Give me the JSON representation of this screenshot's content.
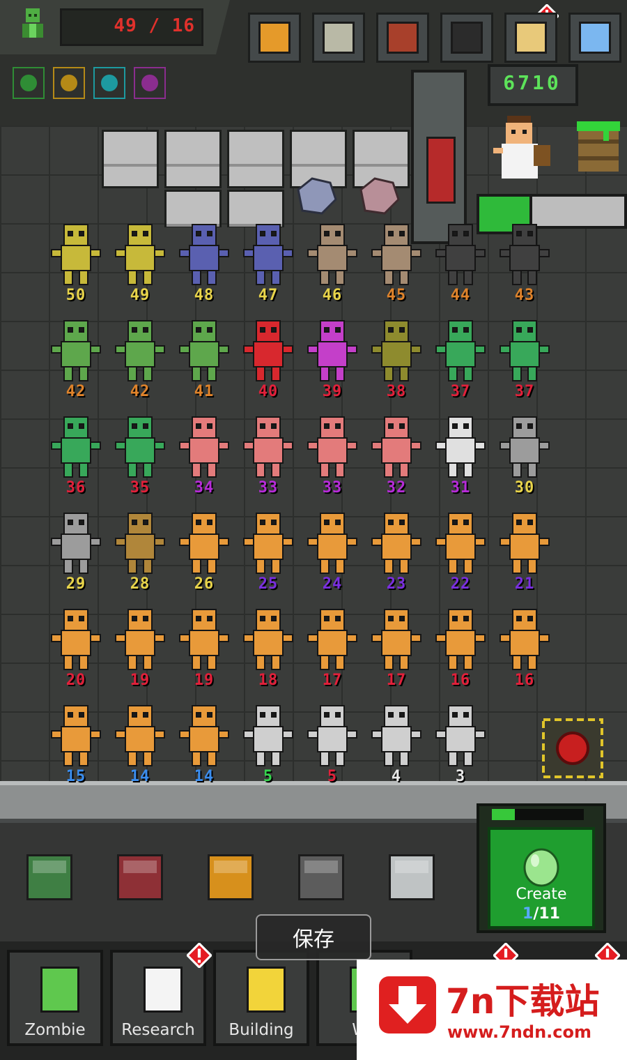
{
  "hud": {
    "population": "49 / 16",
    "money": "6710",
    "top_buttons": [
      {
        "icon": "trophy-icon",
        "color": "#e59a2a"
      },
      {
        "icon": "zombie-head-icon",
        "color": "#b9b9a6"
      },
      {
        "icon": "book-icon",
        "color": "#a8402b"
      },
      {
        "icon": "tablet-icon",
        "color": "#2b2b2b"
      },
      {
        "icon": "scroll-icon",
        "color": "#e8c97a"
      },
      {
        "icon": "gear-icon",
        "color": "#7bb7f0"
      }
    ],
    "boosts": [
      {
        "icon": "flask-boost-icon",
        "color": "#2f8d35"
      },
      {
        "icon": "bomb-boost-icon",
        "color": "#b58a17"
      },
      {
        "icon": "bomb-boost-2-icon",
        "color": "#1d9aa0"
      },
      {
        "icon": "trash-boost-icon",
        "color": "#8b2d8f"
      }
    ]
  },
  "zombie_grid": {
    "rows": [
      [
        {
          "lvl": "50",
          "color": "#e8d44a"
        },
        {
          "lvl": "49",
          "color": "#e8d44a"
        },
        {
          "lvl": "48",
          "color": "#e8d44a"
        },
        {
          "lvl": "47",
          "color": "#e8d44a"
        },
        {
          "lvl": "46",
          "color": "#e8d44a"
        },
        {
          "lvl": "45",
          "color": "#e0832a"
        },
        {
          "lvl": "44",
          "color": "#e0832a"
        },
        {
          "lvl": "43",
          "color": "#e0832a"
        }
      ],
      [
        {
          "lvl": "42",
          "color": "#e0832a"
        },
        {
          "lvl": "42",
          "color": "#e0832a"
        },
        {
          "lvl": "41",
          "color": "#e0832a"
        },
        {
          "lvl": "40",
          "color": "#e2203a"
        },
        {
          "lvl": "39",
          "color": "#e2203a"
        },
        {
          "lvl": "38",
          "color": "#e2203a"
        },
        {
          "lvl": "37",
          "color": "#e2203a"
        },
        {
          "lvl": "37",
          "color": "#e2203a"
        }
      ],
      [
        {
          "lvl": "36",
          "color": "#e2203a"
        },
        {
          "lvl": "35",
          "color": "#e2203a"
        },
        {
          "lvl": "34",
          "color": "#b62bd8"
        },
        {
          "lvl": "33",
          "color": "#b62bd8"
        },
        {
          "lvl": "33",
          "color": "#b62bd8"
        },
        {
          "lvl": "32",
          "color": "#b62bd8"
        },
        {
          "lvl": "31",
          "color": "#b62bd8"
        },
        {
          "lvl": "30",
          "color": "#e8d44a"
        }
      ],
      [
        {
          "lvl": "29",
          "color": "#e8d44a"
        },
        {
          "lvl": "28",
          "color": "#e8d44a"
        },
        {
          "lvl": "26",
          "color": "#e8d44a"
        },
        {
          "lvl": "25",
          "color": "#7a2ee0"
        },
        {
          "lvl": "24",
          "color": "#7a2ee0"
        },
        {
          "lvl": "23",
          "color": "#7a2ee0"
        },
        {
          "lvl": "22",
          "color": "#7a2ee0"
        },
        {
          "lvl": "21",
          "color": "#7a2ee0"
        }
      ],
      [
        {
          "lvl": "20",
          "color": "#e2203a"
        },
        {
          "lvl": "19",
          "color": "#e2203a"
        },
        {
          "lvl": "19",
          "color": "#e2203a"
        },
        {
          "lvl": "18",
          "color": "#e2203a"
        },
        {
          "lvl": "17",
          "color": "#e2203a"
        },
        {
          "lvl": "17",
          "color": "#e2203a"
        },
        {
          "lvl": "16",
          "color": "#e2203a"
        },
        {
          "lvl": "16",
          "color": "#e2203a"
        }
      ],
      [
        {
          "lvl": "15",
          "color": "#3a8dee"
        },
        {
          "lvl": "14",
          "color": "#3a8dee"
        },
        {
          "lvl": "14",
          "color": "#3a8dee"
        },
        {
          "lvl": "5",
          "color": "#36d44e"
        },
        {
          "lvl": "5",
          "color": "#e2203a"
        },
        {
          "lvl": "4",
          "color": "#e8e8e8"
        },
        {
          "lvl": "3",
          "color": "#e8e8e8"
        },
        {
          "lvl": "3",
          "color": "#e8e8e8"
        }
      ]
    ]
  },
  "chests": [
    {
      "icon": "green-chest-icon",
      "color": "#3f7f44"
    },
    {
      "icon": "red-chest-icon",
      "color": "#8e3036"
    },
    {
      "icon": "orange-chest-icon",
      "color": "#d7901c"
    },
    {
      "icon": "gray-chest-icon",
      "color": "#5c5c5c"
    },
    {
      "icon": "silver-chest-icon",
      "color": "#bfc3c4"
    }
  ],
  "create": {
    "label": "Create",
    "current": "1",
    "total": "/11",
    "progress": 0.25
  },
  "toast": "保存",
  "tabs": [
    {
      "label": "Zombie",
      "icon": "zombie-hand-icon",
      "badge": false
    },
    {
      "label": "Research",
      "icon": "clipboard-icon",
      "badge": true
    },
    {
      "label": "Building",
      "icon": "hardhat-icon",
      "badge": false
    },
    {
      "label": "We",
      "icon": "weapon-icon",
      "badge": false
    }
  ],
  "watermark": {
    "title": "7n下载站",
    "url": "www.7ndn.com"
  }
}
